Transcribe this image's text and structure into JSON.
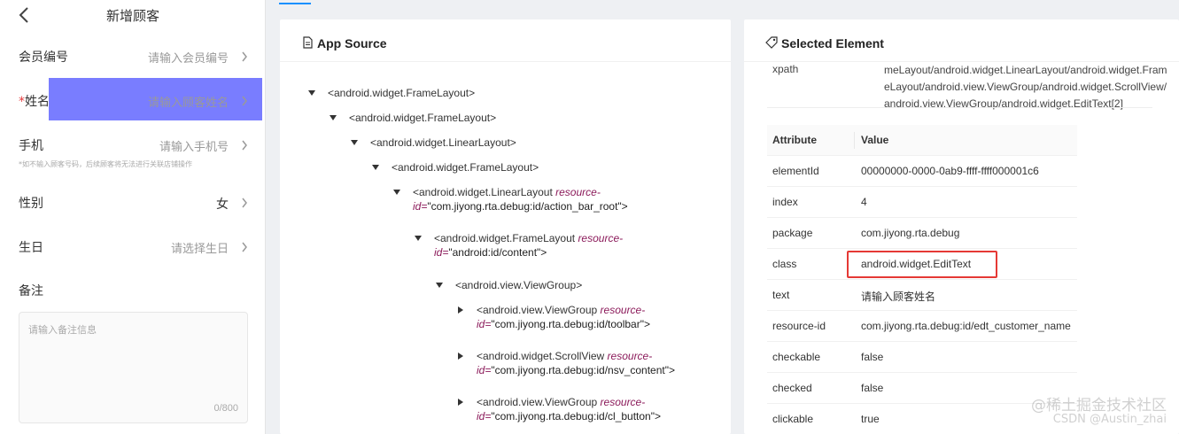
{
  "phone": {
    "title": "新增顾客",
    "rows": [
      {
        "label": "会员编号",
        "value": "请输入会员编号"
      },
      {
        "label": "姓名",
        "required_mark": "*",
        "value": "请输入顾客姓名"
      },
      {
        "label": "手机",
        "value": "请输入手机号"
      },
      {
        "label": "性别",
        "value": "女"
      },
      {
        "label": "生日",
        "value": "请选择生日"
      },
      {
        "label": "备注"
      }
    ],
    "phone_hint": "*如不输入顾客号码，后续顾客将无法进行关联店铺操作",
    "note_placeholder": "请输入备注信息",
    "note_count": "0/800",
    "highlight_color": "#585cff"
  },
  "source": {
    "title": "App Source",
    "nodes": [
      {
        "tag": "<android.widget.FrameLayout>",
        "expanded": true
      },
      {
        "tag": "<android.widget.FrameLayout>",
        "expanded": true
      },
      {
        "tag": "<android.widget.LinearLayout>",
        "expanded": true
      },
      {
        "tag": "<android.widget.FrameLayout>",
        "expanded": true
      },
      {
        "tag": "<android.widget.LinearLayout",
        "attr": "resource-",
        "line2_prefix": "id=",
        "line2_value": "\"com.jiyong.rta.debug:id/action_bar_root\">",
        "expanded": true
      },
      {
        "tag": "<android.widget.FrameLayout",
        "attr": "resource-",
        "line2_prefix": "id=",
        "line2_value": "\"android:id/content\">",
        "expanded": true
      },
      {
        "tag": "<android.view.ViewGroup>",
        "expanded": true
      },
      {
        "tag": "<android.view.ViewGroup",
        "attr": "resource-",
        "line2_prefix": "id=",
        "line2_value": "\"com.jiyong.rta.debug:id/toolbar\">",
        "expanded": false
      },
      {
        "tag": "<android.widget.ScrollView",
        "attr": "resource-",
        "line2_prefix": "id=",
        "line2_value": "\"com.jiyong.rta.debug:id/nsv_content\">",
        "expanded": false
      },
      {
        "tag": "<android.view.ViewGroup",
        "attr": "resource-",
        "line2_prefix": "id=",
        "line2_value": "\"com.jiyong.rta.debug:id/cl_button\">",
        "expanded": false
      }
    ]
  },
  "selected": {
    "title": "Selected Element",
    "xpath_label": "xpath",
    "xpath_value": "meLayout/android.widget.LinearLayout/android.widget.FrameLayout/android.view.ViewGroup/android.widget.ScrollView/android.view.ViewGroup/android.widget.EditText[2]",
    "header": {
      "k": "Attribute",
      "v": "Value"
    },
    "attributes": [
      {
        "k": "elementId",
        "v": "00000000-0000-0ab9-ffff-ffff000001c6"
      },
      {
        "k": "index",
        "v": "4"
      },
      {
        "k": "package",
        "v": "com.jiyong.rta.debug"
      },
      {
        "k": "class",
        "v": "android.widget.EditText"
      },
      {
        "k": "text",
        "v": "请输入顾客姓名"
      },
      {
        "k": "resource-id",
        "v": "com.jiyong.rta.debug:id/edt_customer_name"
      },
      {
        "k": "checkable",
        "v": "false"
      },
      {
        "k": "checked",
        "v": "false"
      },
      {
        "k": "clickable",
        "v": "true"
      }
    ],
    "highlight_border_color": "#e53935"
  },
  "watermark": {
    "line1": "@稀土掘金技术社区",
    "line2": "CSDN @Austin_zhai"
  }
}
